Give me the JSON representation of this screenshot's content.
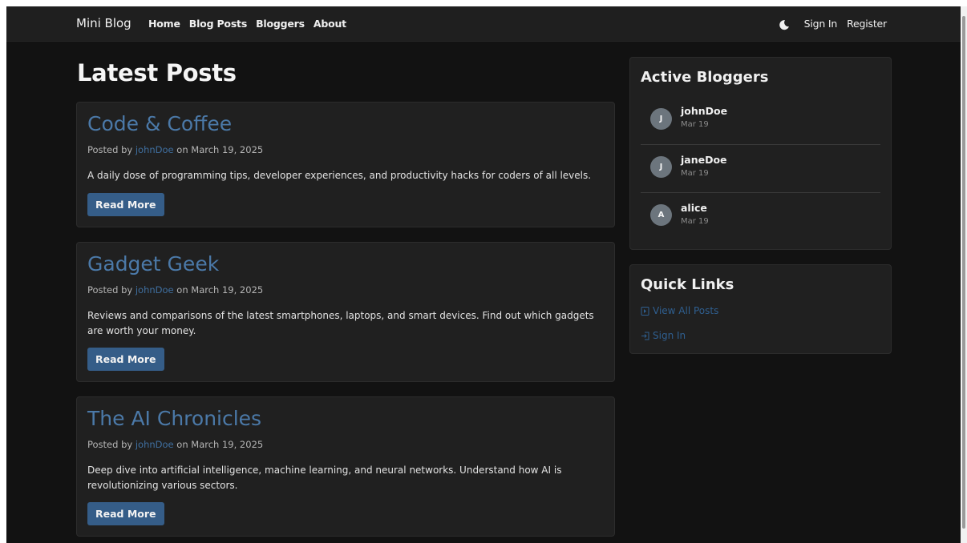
{
  "nav": {
    "brand": "Mini Blog",
    "links": [
      "Home",
      "Blog Posts",
      "Bloggers",
      "About"
    ],
    "sign_in": "Sign In",
    "register": "Register",
    "theme_icon": "moon-icon"
  },
  "main": {
    "title": "Latest Posts",
    "posts": [
      {
        "title": "Code & Coffee",
        "posted_by": "Posted by ",
        "author": "johnDoe",
        "on_date": " on March 19, 2025",
        "excerpt": "A daily dose of programming tips, developer experiences, and productivity hacks for coders of all levels.",
        "button": "Read More"
      },
      {
        "title": "Gadget Geek",
        "posted_by": "Posted by ",
        "author": "johnDoe",
        "on_date": " on March 19, 2025",
        "excerpt": "Reviews and comparisons of the latest smartphones, laptops, and smart devices. Find out which gadgets are worth your money.",
        "button": "Read More"
      },
      {
        "title": "The AI Chronicles",
        "posted_by": "Posted by ",
        "author": "johnDoe",
        "on_date": " on March 19, 2025",
        "excerpt": "Deep dive into artificial intelligence, machine learning, and neural networks. Understand how AI is revolutionizing various sectors.",
        "button": "Read More"
      }
    ]
  },
  "sidebar": {
    "bloggers_title": "Active Bloggers",
    "bloggers": [
      {
        "initial": "J",
        "name": "johnDoe",
        "date": "Mar 19"
      },
      {
        "initial": "J",
        "name": "janeDoe",
        "date": "Mar 19"
      },
      {
        "initial": "A",
        "name": "alice",
        "date": "Mar 19"
      }
    ],
    "quick_links_title": "Quick Links",
    "quick_links": [
      {
        "label": "View All Posts",
        "icon": "file-icon"
      },
      {
        "label": "Sign In",
        "icon": "sign-in-icon"
      }
    ]
  },
  "colors": {
    "background": "#121212",
    "card": "#202020",
    "link": "#4b79a8",
    "button": "#355d88"
  }
}
